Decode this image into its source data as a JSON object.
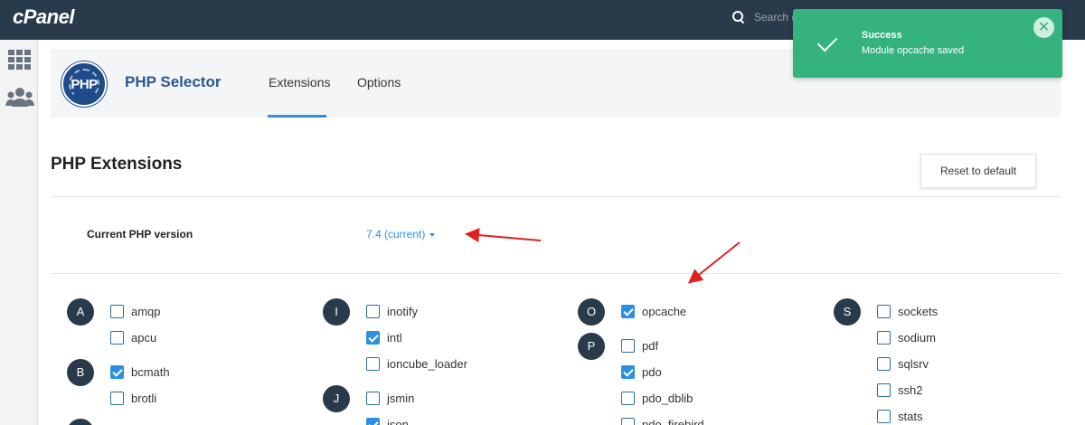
{
  "topbar": {
    "logo": "cPanel",
    "search_placeholder": "Search ("
  },
  "header": {
    "title": "PHP Selector",
    "logo_text": "PHP",
    "tabs": [
      {
        "label": "Extensions"
      },
      {
        "label": "Options"
      }
    ]
  },
  "toast": {
    "title": "Success",
    "message": "Module opcache saved"
  },
  "section": {
    "title": "PHP Extensions",
    "reset_label": "Reset to default",
    "version_label": "Current PHP version",
    "version_value": "7.4 (current)"
  },
  "letters": {
    "a": "A",
    "b": "B",
    "i": "I",
    "j": "J",
    "o": "O",
    "p": "P",
    "s": "S"
  },
  "extensions": {
    "amqp": {
      "label": "amqp",
      "checked": false
    },
    "apcu": {
      "label": "apcu",
      "checked": false
    },
    "bcmath": {
      "label": "bcmath",
      "checked": true
    },
    "brotli": {
      "label": "brotli",
      "checked": false
    },
    "inotify": {
      "label": "inotify",
      "checked": false
    },
    "intl": {
      "label": "intl",
      "checked": true
    },
    "ioncube_loader": {
      "label": "ioncube_loader",
      "checked": false
    },
    "jsmin": {
      "label": "jsmin",
      "checked": false
    },
    "json": {
      "label": "json",
      "checked": true
    },
    "opcache": {
      "label": "opcache",
      "checked": true
    },
    "pdf": {
      "label": "pdf",
      "checked": false
    },
    "pdo": {
      "label": "pdo",
      "checked": true
    },
    "pdo_dblib": {
      "label": "pdo_dblib",
      "checked": false
    },
    "pdo_firebird": {
      "label": "pdo_firebird",
      "checked": false
    },
    "sockets": {
      "label": "sockets",
      "checked": false
    },
    "sodium": {
      "label": "sodium",
      "checked": false
    },
    "sqlsrv": {
      "label": "sqlsrv",
      "checked": false
    },
    "ssh2": {
      "label": "ssh2",
      "checked": false
    },
    "stats": {
      "label": "stats",
      "checked": false
    }
  },
  "colors": {
    "topbar": "#293a4a",
    "accent": "#2d8fe0",
    "toast": "#34b37e",
    "title": "#2b5792",
    "annotation_arrow": "#e02020"
  }
}
